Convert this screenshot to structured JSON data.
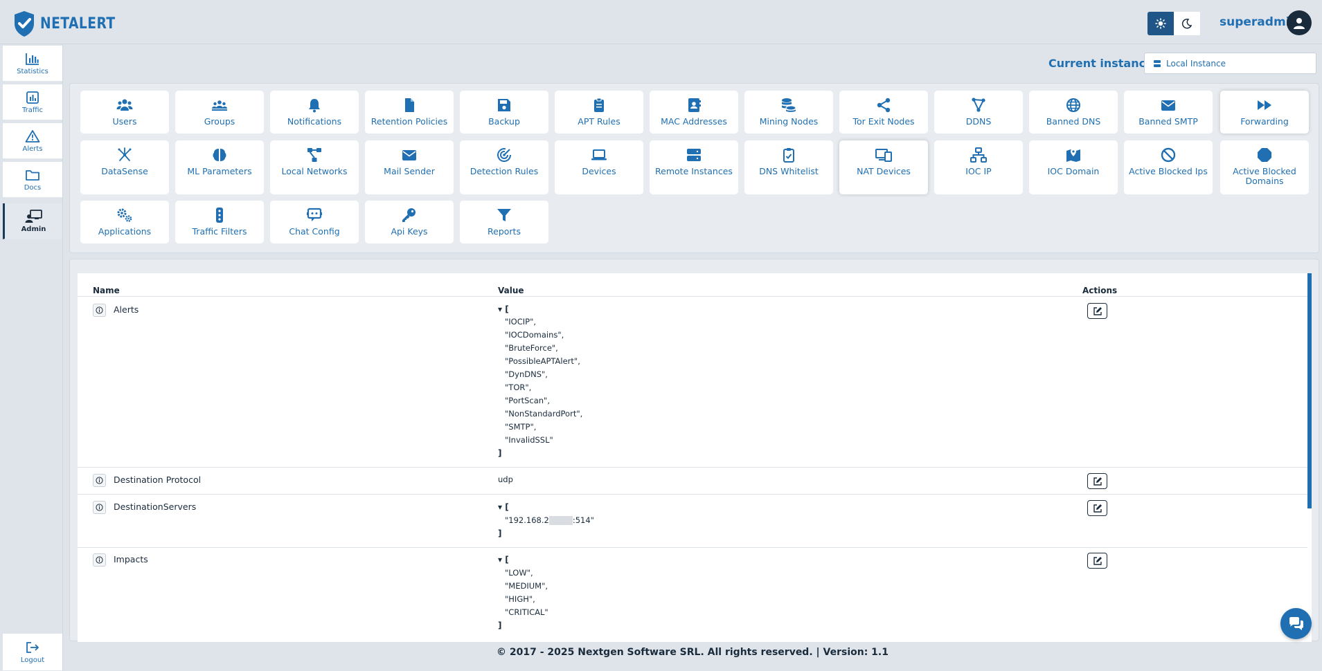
{
  "app": {
    "brand": "NETALERT"
  },
  "header": {
    "user": "superadmin"
  },
  "sidebar": {
    "items": [
      {
        "label": "Statistics",
        "icon": "chart-bar-icon"
      },
      {
        "label": "Traffic",
        "icon": "traffic-chart-icon"
      },
      {
        "label": "Alerts",
        "icon": "warning-icon"
      },
      {
        "label": "Docs",
        "icon": "folder-icon"
      },
      {
        "label": "Admin",
        "icon": "admin-icon",
        "active": true
      }
    ],
    "logout": "Logout"
  },
  "instance": {
    "label": "Current instance:",
    "value": "Local Instance"
  },
  "menu": {
    "row1": [
      "Users",
      "Groups",
      "Notifications",
      "Retention Policies",
      "Backup",
      "APT Rules",
      "MAC Addresses",
      "Mining Nodes",
      "Tor Exit Nodes",
      "DDNS",
      "Banned DNS",
      "Banned SMTP",
      "Forwarding"
    ],
    "row2": [
      "DataSense",
      "ML Parameters",
      "Local Networks",
      "Mail Sender",
      "Detection Rules",
      "Devices",
      "Remote Instances",
      "DNS Whitelist",
      "NAT Devices",
      "IOC IP",
      "IOC Domain",
      "Active Blocked Ips",
      "Active Blocked Domains"
    ],
    "row3": [
      "Applications",
      "Traffic Filters",
      "Chat Config",
      "Api Keys",
      "Reports"
    ]
  },
  "table": {
    "headers": {
      "name": "Name",
      "value": "Value",
      "actions": "Actions"
    },
    "rows": {
      "alerts": {
        "name": "Alerts",
        "open": "▾ [",
        "items": [
          "\"IOCIP\",",
          "\"IOCDomains\",",
          "\"BruteForce\",",
          "\"PossibleAPTAlert\",",
          "\"DynDNS\",",
          "\"TOR\",",
          "\"PortScan\",",
          "\"NonStandardPort\",",
          "\"SMTP\",",
          "\"InvalidSSL\""
        ],
        "close": "]"
      },
      "protocol": {
        "name": "Destination Protocol",
        "value": "udp"
      },
      "servers": {
        "name": "DestinationServers",
        "open": "▾ [",
        "prefix": "\"192.168.2",
        "suffix": ":514\"",
        "close": "]"
      },
      "impacts": {
        "name": "Impacts",
        "open": "▾ [",
        "items": [
          "\"LOW\",",
          "\"MEDIUM\",",
          "\"HIGH\",",
          "\"CRITICAL\""
        ],
        "close": "]"
      }
    }
  },
  "footer": {
    "text": "© 2017 - 2025 Nextgen Software SRL. All rights reserved. | Version: 1.1"
  },
  "colors": {
    "accent": "#1f6fb2",
    "dark": "#1a2b3c",
    "background": "#dfe4ea"
  }
}
